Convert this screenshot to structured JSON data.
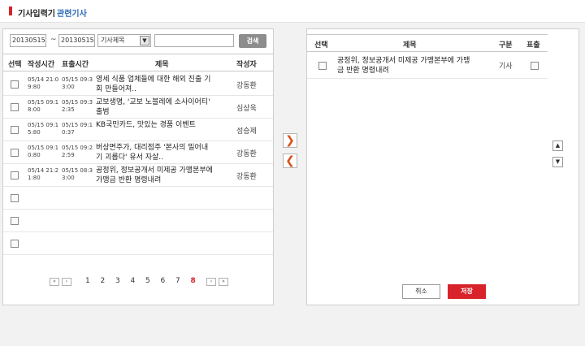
{
  "header": {
    "title": "기사입력기",
    "subtitle": "관련기사"
  },
  "search": {
    "start_date": "20130515",
    "tilde": "~",
    "end_date": "20130515",
    "field_select": "기사제목",
    "keyword": "",
    "button": "검색"
  },
  "left_table": {
    "columns": {
      "select": "선택",
      "created": "작성시간",
      "published": "표출시간",
      "title": "제목",
      "writer": "작성자"
    },
    "rows": [
      {
        "created": "05/14 21:0\n9:80",
        "published": "05/15 09:3\n3:00",
        "title": "영세 식품 업체들에 대한 해외 진출 기\n회 만들어져..",
        "writer": "강동환"
      },
      {
        "created": "05/15 09:1\n8:00",
        "published": "05/15 09:3\n2:35",
        "title": "교보생명, '교보 노블레에 소사이어티'\n출범",
        "writer": "심상욱"
      },
      {
        "created": "05/15 09:1\n5:80",
        "published": "05/15 09:1\n0:37",
        "title": "KB국민카드, 맛있는 경품 이벤트",
        "writer": "성승제"
      },
      {
        "created": "05/15 09:1\n0:80",
        "published": "05/15 09:2\n2:59",
        "title": "버상면주가, 대리점주 '본사의 밀어내\n기 괴롭다' 유서 자살..",
        "writer": "강동환"
      },
      {
        "created": "05/14 21:2\n1:80",
        "published": "05/15 08:3\n3:00",
        "title": "공정위, 정보공개서 미제공 가맹본부에\n가맹금 반환 명령내려",
        "writer": "강동환"
      },
      {
        "created": "",
        "published": "",
        "title": "",
        "writer": ""
      },
      {
        "created": "",
        "published": "",
        "title": "",
        "writer": ""
      },
      {
        "created": "",
        "published": "",
        "title": "",
        "writer": ""
      }
    ]
  },
  "pagination": {
    "first": "«",
    "prev": "‹",
    "pages": [
      "1",
      "2",
      "3",
      "4",
      "5",
      "6",
      "7",
      "8"
    ],
    "current": "8",
    "next": "›",
    "last": "»"
  },
  "move": {
    "add": "❯",
    "remove": "❮"
  },
  "order": {
    "up": "▲",
    "down": "▼"
  },
  "right_table": {
    "columns": {
      "select": "선택",
      "title": "제목",
      "type": "구분",
      "display": "표출"
    },
    "rows": [
      {
        "title": "공정위, 정보공개서 미제공 가맹본부에 가맹\n금 반환 명령내려",
        "type": "기사"
      }
    ]
  },
  "actions": {
    "cancel": "취소",
    "save": "저장"
  },
  "colors": {
    "accent": "#d8232a",
    "link": "#2a6cb8",
    "move_arrow": "#d8501c"
  },
  "icons": {
    "move_add": "chevron-right-icon",
    "move_remove": "chevron-left-icon",
    "up": "arrow-up-icon",
    "down": "arrow-down-icon"
  }
}
